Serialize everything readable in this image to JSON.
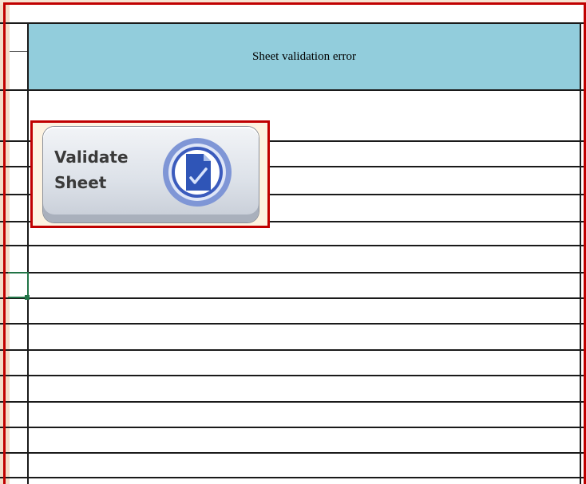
{
  "sheet": {
    "header_title": "Sheet validation error"
  },
  "validate_button": {
    "label": "Validate\nSheet",
    "icon": "document-check-icon",
    "icon_colors": {
      "ring_outer": "#7f96d6",
      "ring_inner": "#3b5bbd",
      "doc": "#2f55b7"
    }
  },
  "colors": {
    "header_fill": "#92cddc",
    "outline": "#c00000",
    "grid_line": "#1a1a1a",
    "selection": "#217346"
  }
}
